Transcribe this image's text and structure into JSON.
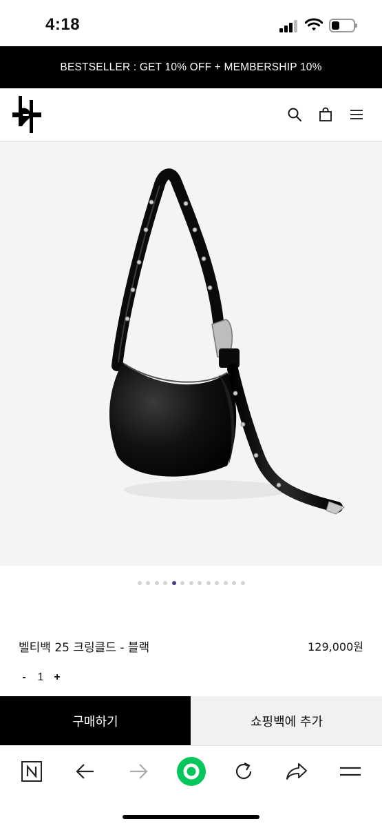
{
  "status_bar": {
    "time": "4:18",
    "icons": [
      "cellular-signal-icon",
      "wifi-icon",
      "battery-icon"
    ],
    "battery_level": 0.35
  },
  "promo_banner": {
    "text": "BESTSELLER : GET 10% OFF + MEMBERSHIP 10%"
  },
  "header": {
    "icons": [
      "brand-logo",
      "search-icon",
      "shopping-bag-icon",
      "menu-icon"
    ]
  },
  "gallery": {
    "image_description_icon": "black-shoulder-bag-with-buckle-strap",
    "total_slides": 13,
    "active_slide": 5
  },
  "product": {
    "name": "벨티백 25 크링클드 - 블랙",
    "price": "129,000원",
    "quantity": {
      "minus_label": "-",
      "value": "1",
      "plus_label": "+"
    }
  },
  "actions": {
    "buy_label": "구매하기",
    "add_to_cart_label": "쇼핑백에 추가"
  },
  "browser_toolbar": {
    "icons": [
      "naver-n-icon",
      "back-arrow-icon",
      "forward-arrow-icon",
      "green-home-icon",
      "refresh-icon",
      "share-icon",
      "menu-icon"
    ],
    "accent_color": "#03c75a"
  },
  "colors": {
    "promo_bg": "#000000",
    "buy_button_bg": "#000000",
    "cart_button_bg": "#f1f1f1",
    "active_dot": "#4b3a8c"
  }
}
